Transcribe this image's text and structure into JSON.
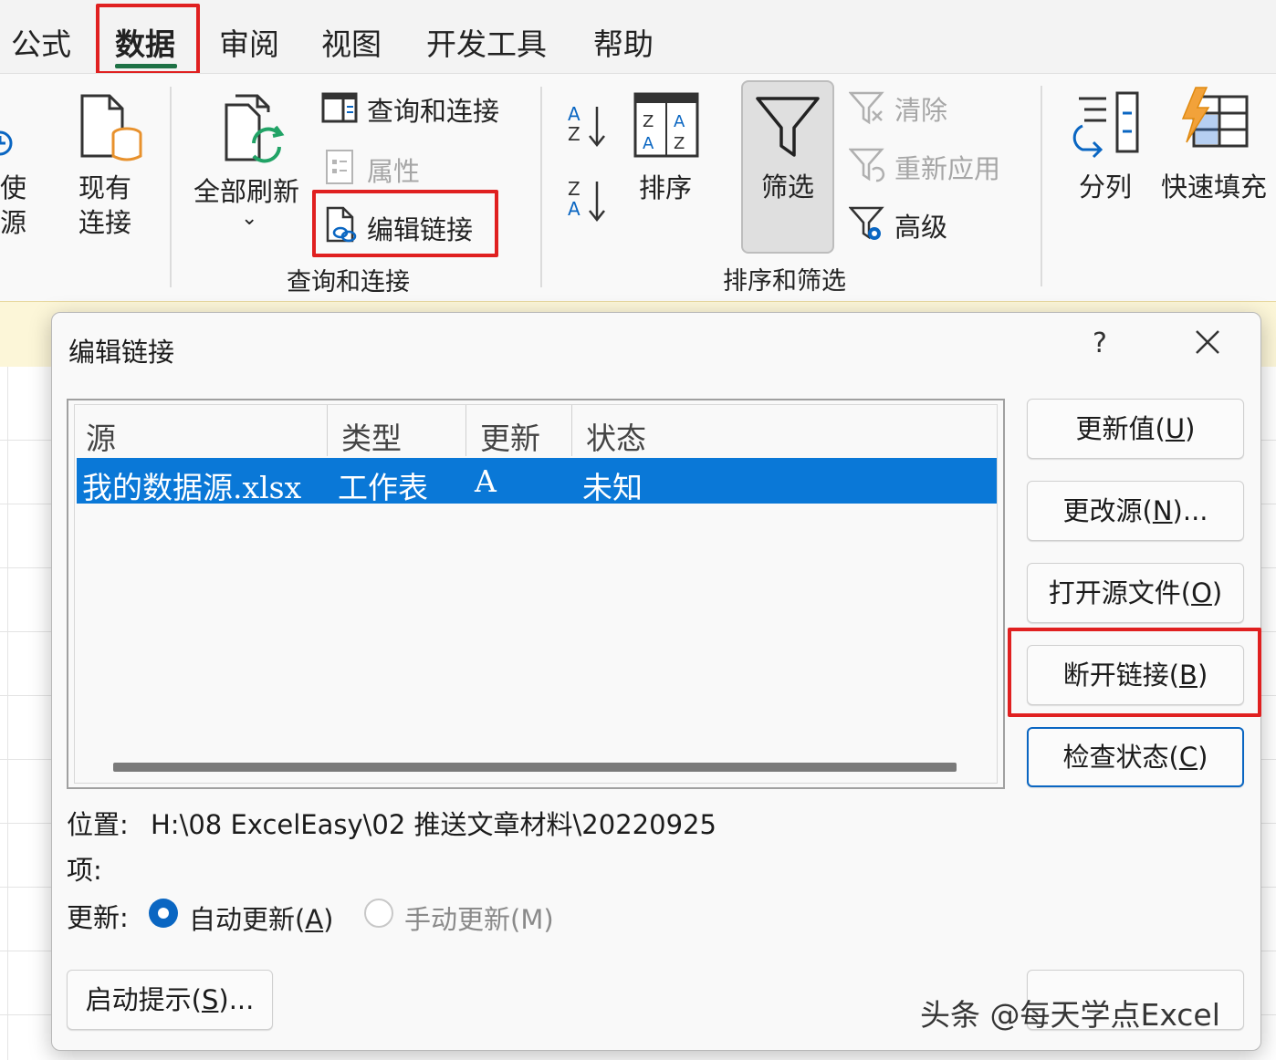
{
  "tabs": [
    {
      "label": "公式",
      "active": false
    },
    {
      "label": "数据",
      "active": true
    },
    {
      "label": "审阅",
      "active": false
    },
    {
      "label": "视图",
      "active": false
    },
    {
      "label": "开发工具",
      "active": false
    },
    {
      "label": "帮助",
      "active": false
    }
  ],
  "ribbon": {
    "partial_left": {
      "line1": "使",
      "line2": "源"
    },
    "existing_connections": {
      "line1": "现有",
      "line2": "连接"
    },
    "refresh_all": {
      "label": "全部刷新",
      "chevron": "⌄"
    },
    "queries_connections": "查询和连接",
    "properties": "属性",
    "edit_links": "编辑链接",
    "group_queries": "查询和连接",
    "sort_az": {
      "top": "A",
      "bottom": "Z"
    },
    "sort_za": {
      "top": "Z",
      "bottom": "A"
    },
    "sort": "排序",
    "filter": "筛选",
    "clear": "清除",
    "reapply": "重新应用",
    "advanced": "高级",
    "group_sort_filter": "排序和筛选",
    "text_to_columns": "分列",
    "flash_fill": "快速填充"
  },
  "dialog": {
    "title": "编辑链接",
    "help": "?",
    "columns": [
      "源",
      "类型",
      "更新",
      "状态"
    ],
    "rows": [
      {
        "source": "我的数据源.xlsx",
        "type": "工作表",
        "update": "A",
        "status": "未知",
        "selected": true
      }
    ],
    "buttons": {
      "update_values": {
        "text": "更新值(",
        "key": "U",
        "tail": ")"
      },
      "change_source": {
        "text": "更改源(",
        "key": "N",
        "tail": ")..."
      },
      "open_source": {
        "text": "打开源文件(",
        "key": "O",
        "tail": ")"
      },
      "break_link": {
        "text": "断开链接(",
        "key": "B",
        "tail": ")"
      },
      "check_status": {
        "text": "检查状态(",
        "key": "C",
        "tail": ")"
      },
      "startup_prompt": {
        "text": "启动提示(",
        "key": "S",
        "tail": ")..."
      }
    },
    "location_label": "位置:",
    "location_value": "H:\\08 ExcelEasy\\02 推送文章材料\\20220925",
    "item_label": "项:",
    "update_label": "更新:",
    "auto_update": {
      "text": "自动更新(",
      "key": "A",
      "tail": ")",
      "selected": true
    },
    "manual_update": {
      "text": "手动更新(M)",
      "selected": false
    }
  },
  "watermark": "头条 @每天学点Excel",
  "colors": {
    "accent_green": "#1e7145",
    "highlight_red": "#e02020",
    "selection_blue": "#0a78d7",
    "radio_blue": "#0a66c2"
  }
}
